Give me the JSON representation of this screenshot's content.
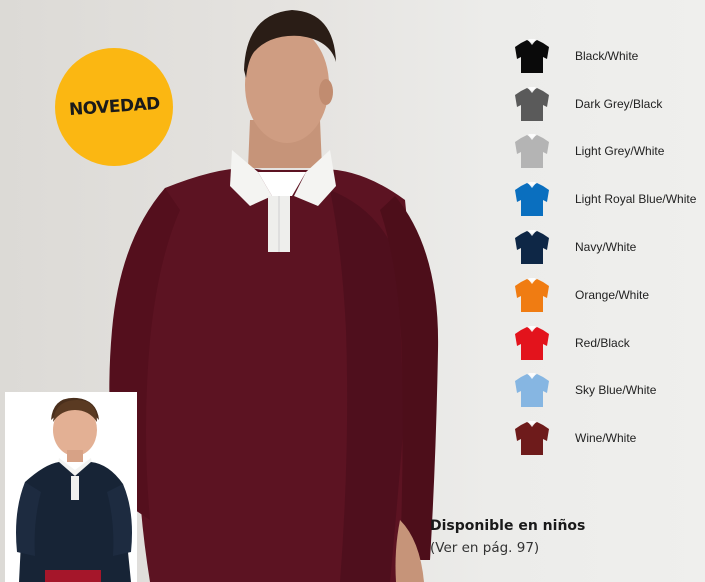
{
  "badge": {
    "text": "NOVEDAD",
    "color": "#fbb712"
  },
  "swatches": [
    {
      "label": "Black/White",
      "color": "#0a0a0a",
      "collar": "#0a0a0a"
    },
    {
      "label": "Dark Grey/Black",
      "color": "#5a5a5a",
      "collar": "#5a5a5a"
    },
    {
      "label": "Light Grey/White",
      "color": "#b4b4b4",
      "collar": "#b4b4b4"
    },
    {
      "label": "Light Royal Blue/White",
      "color": "#0a6fbf",
      "collar": "#0a6fbf"
    },
    {
      "label": "Navy/White",
      "color": "#0e2746",
      "collar": "#0e2746"
    },
    {
      "label": "Orange/White",
      "color": "#f07c12",
      "collar": "#f07c12"
    },
    {
      "label": "Red/Black",
      "color": "#e3131c",
      "collar": "#e3131c"
    },
    {
      "label": "Sky Blue/White",
      "color": "#86b6e2",
      "collar": "#86b6e2"
    },
    {
      "label": "Wine/White",
      "color": "#6e1b1b",
      "collar": "#6e1b1b"
    }
  ],
  "kids": {
    "title": "Disponible en niños",
    "subtitle": "(Ver en pág. 97)"
  }
}
